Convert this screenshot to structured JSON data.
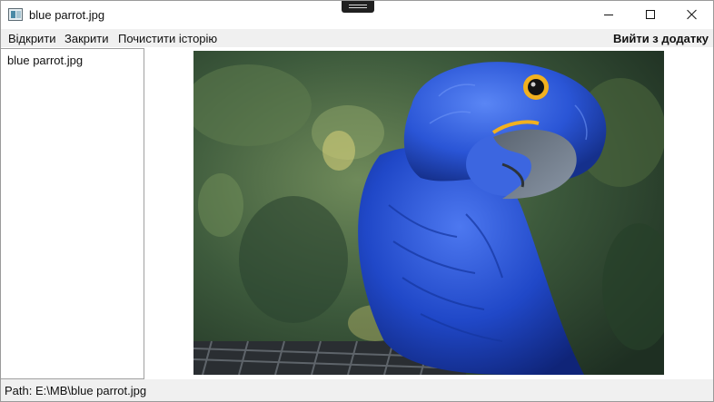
{
  "window": {
    "title": "blue parrot.jpg",
    "icon": "image-viewer-app-icon"
  },
  "caption_buttons": {
    "minimize_icon": "minimize-icon",
    "maximize_icon": "maximize-icon",
    "close_icon": "close-icon"
  },
  "menu": {
    "open": "Відкрити",
    "close": "Закрити",
    "clear_history": "Почистити історію",
    "exit": "Вийти з додатку"
  },
  "history": {
    "items": [
      "blue parrot.jpg"
    ]
  },
  "viewer": {
    "image_subject": "blue parrot photo"
  },
  "status": {
    "path": "Path: E:\\MB\\blue parrot.jpg"
  },
  "colors": {
    "menu_background": "#f0f0f0",
    "parrot_blue": "#1f4fd0",
    "foliage_green": "#3f5a3a"
  }
}
